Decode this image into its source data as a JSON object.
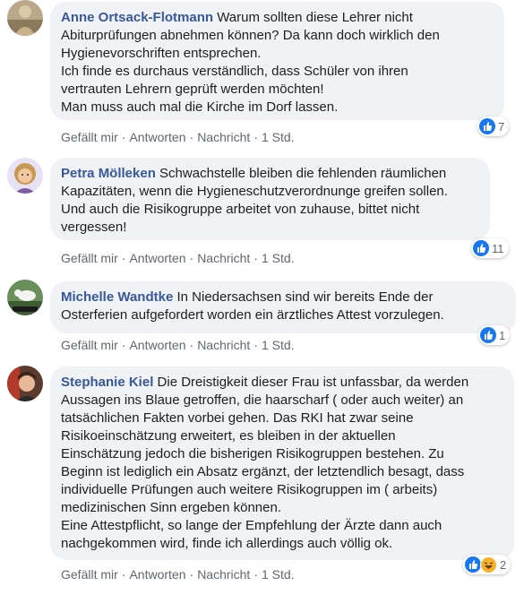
{
  "comments": [
    {
      "author": "Anne Ortsack-Flotmann",
      "text": " Warum sollten diese Lehrer nicht\nAbiturprüfungen abnehmen können? Da kann doch wirklich den\nHygienevorschriften entsprechen.\nIch finde es durchaus verständlich, dass Schüler von ihren\nvertrauten Lehrern geprüft werden möchten!\nMan muss auch mal die Kirche im Dorf lassen.",
      "actions": [
        "Gefällt mir",
        "Antworten",
        "Nachricht",
        "1 Std."
      ],
      "reaction_count": "7"
    },
    {
      "author": "Petra Mölleken",
      "text": " Schwachstelle bleiben die fehlenden räumlichen\nKapazitäten, wenn die Hygieneschutzverordnunge greifen sollen.\nUnd auch die Risikogruppe arbeitet von zuhause, bittet nicht\nvergessen!",
      "actions": [
        "Gefällt mir",
        "Antworten",
        "Nachricht",
        "1 Std."
      ],
      "reaction_count": "11"
    },
    {
      "author": "Michelle Wandtke",
      "text": " In Niedersachsen sind wir bereits Ende der\nOsterferien aufgefordert worden ein ärztliches Attest vorzulegen.",
      "actions": [
        "Gefällt mir",
        "Antworten",
        "Nachricht",
        "1 Std."
      ],
      "reaction_count": "1"
    },
    {
      "author": "Stephanie Kiel",
      "text": " Die Dreistigkeit dieser Frau ist unfassbar, da werden\nAussagen ins Blaue getroffen, die haarscharf ( oder auch weiter) an\ntatsächlichen Fakten vorbei gehen. Das RKI hat zwar seine\nRisikoeinschätzung erweitert, es bleiben in der aktuellen\nEinschätzung jedoch die bisherigen Risikogruppen bestehen. Zu\nBeginn ist lediglich ein Absatz ergänzt, der letztendlich besagt, dass\nindividuelle Prüfungen auch weitere Risikogruppen im ( arbeits)\nmedizinischen Sinn ergeben können.\nEine Attestpflicht, so lange der Empfehlung der Ärzte dann auch\nnachgekommen wird, finde ich allerdings auch völlig ok.",
      "actions": [
        "Gefällt mir",
        "Antworten",
        "Nachricht",
        "1 Std."
      ],
      "reaction_count": "2"
    }
  ],
  "colors": {
    "author": "#385898",
    "bubble": "#f0f2f5",
    "like": "#1877f2",
    "haha": "#f7b125",
    "meta": "#606770"
  },
  "icons": [
    "like-icon",
    "haha-icon"
  ]
}
